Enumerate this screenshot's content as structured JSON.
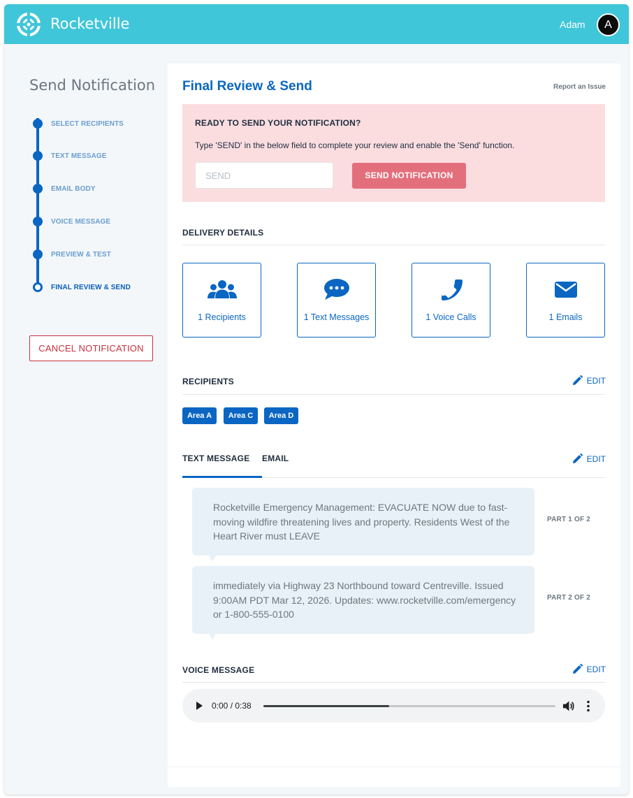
{
  "header": {
    "brand": "Rocketville",
    "user_name": "Adam",
    "avatar_initial": "A",
    "logo_icon": "crosshair-ring-icon"
  },
  "sidebar": {
    "title": "Send Notification",
    "steps": [
      {
        "label": "SELECT RECIPIENTS",
        "state": "completed"
      },
      {
        "label": "TEXT MESSAGE",
        "state": "completed"
      },
      {
        "label": "EMAIL BODY",
        "state": "completed"
      },
      {
        "label": "VOICE MESSAGE",
        "state": "completed"
      },
      {
        "label": "PREVIEW & TEST",
        "state": "completed"
      },
      {
        "label": "FINAL REVIEW & SEND",
        "state": "current"
      }
    ],
    "cancel_label": "CANCEL NOTIFICATION"
  },
  "main": {
    "title": "Final Review & Send",
    "report_link": "Report an Issue",
    "confirm": {
      "heading": "READY TO SEND YOUR NOTIFICATION?",
      "instruction": "Type 'SEND' in the below field to complete your review and enable the 'Send' function.",
      "input_value": "",
      "input_placeholder": "SEND",
      "send_label": "SEND NOTIFICATION",
      "send_enabled": false
    },
    "delivery": {
      "heading": "DELIVERY DETAILS",
      "cards": [
        {
          "label": "1 Recipients",
          "icon": "users-icon"
        },
        {
          "label": "1 Text Messages",
          "icon": "chat-bubble-icon"
        },
        {
          "label": "1 Voice Calls",
          "icon": "phone-icon"
        },
        {
          "label": "1 Emails",
          "icon": "envelope-icon"
        }
      ]
    },
    "recipients": {
      "heading": "RECIPIENTS",
      "edit_label": "EDIT",
      "areas": [
        "Area A",
        "Area C",
        "Area D"
      ]
    },
    "message_tabs": {
      "tabs": [
        "TEXT MESSAGE",
        "EMAIL"
      ],
      "active_tab": "TEXT MESSAGE",
      "edit_label": "EDIT",
      "parts": [
        {
          "text": "Rocketville Emergency Management: EVACUATE NOW due to fast-moving wildfire threatening lives and property. Residents West of the Heart River must LEAVE",
          "label": "PART 1 OF 2"
        },
        {
          "text": "immediately via Highway 23 Northbound toward Centreville. Issued 9:00AM PDT Mar 12, 2026. Updates: www.rocketville.com/emergency or 1-800-555-0100",
          "label": "PART 2 OF 2"
        }
      ]
    },
    "voice": {
      "heading": "VOICE MESSAGE",
      "edit_label": "EDIT",
      "time_display": "0:00 / 0:38",
      "progress": 0.43
    }
  },
  "colors": {
    "header": "#40c6d9",
    "accent": "#0a66c2",
    "danger": "#c8303e",
    "alert_bg": "#fbdde0",
    "send_button": "#e46f7c"
  }
}
